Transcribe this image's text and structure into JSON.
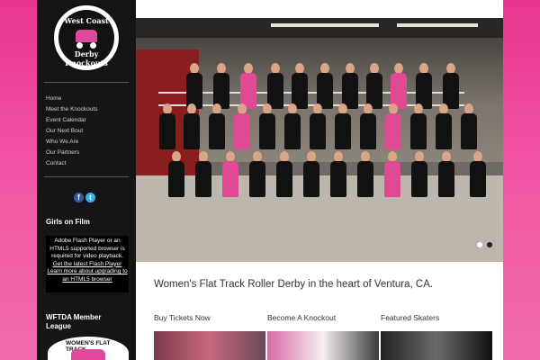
{
  "logo": {
    "title": "West Coast",
    "subtitle": "Derby Knockouts"
  },
  "nav": [
    "Home",
    "Meet the Knockouts",
    "Event Calendar",
    "Our Next Bout",
    "Who We Are",
    "Our Partners",
    "Contact"
  ],
  "social": {
    "facebook": "f",
    "twitter": "t",
    "facebook_color": "#3b5998",
    "twitter_color": "#33b5e5"
  },
  "sidebar": {
    "girls_on_film_heading": "Girls on Film",
    "flash_message_1": "Adobe Flash Player or an HTML5 supported browser is required for video playback.",
    "flash_link_1": "Get the latest Flash Player",
    "flash_link_2": "Learn more about upgrading to an HTML5 browser",
    "wftda_heading": "WFTDA Member League",
    "wftda_logo_text": "WOMEN'S FLAT TRACK"
  },
  "slider": {
    "slide_count": 2,
    "active_index": 0,
    "active_color": "#ffffff",
    "inactive_color": "#222222"
  },
  "main": {
    "tagline": "Women's Flat Track Roller Derby in the heart of Ventura, CA.",
    "columns": [
      "Buy Tickets Now",
      "Become A Knockout",
      "Featured Skaters"
    ]
  },
  "colors": {
    "brand_pink": "#e9358f",
    "sidebar_bg": "#151515"
  }
}
